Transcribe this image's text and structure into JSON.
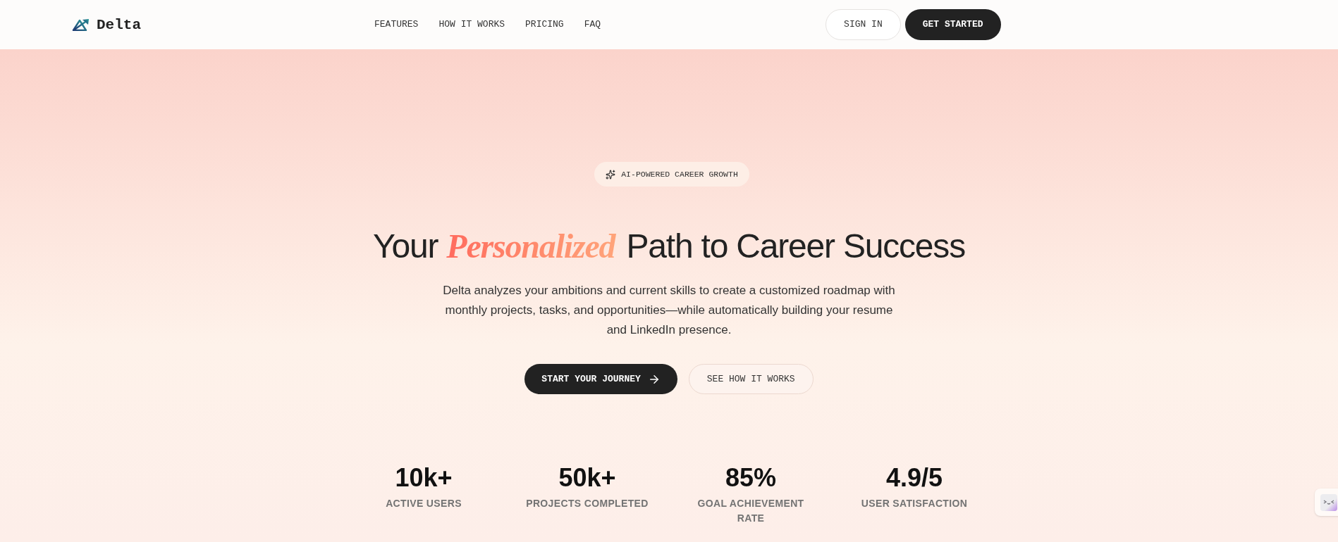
{
  "header": {
    "logo": {
      "text": "Delta"
    },
    "nav": [
      "FEATURES",
      "HOW IT WORKS",
      "PRICING",
      "FAQ"
    ],
    "buttons": [
      {
        "label": "SIGN IN",
        "kind": "outline"
      },
      {
        "label": "GET STARTED",
        "kind": "solid"
      }
    ]
  },
  "hero": {
    "badge": "AI-POWERED CAREER GROWTH",
    "heading": {
      "before": "Your",
      "highlight": "Personalized",
      "after": "Path to Career Success"
    },
    "description": "Delta analyzes your ambitions and current skills to create a customized roadmap with monthly projects, tasks, and opportunities—while automatically building your resume and LinkedIn presence.",
    "actions": [
      {
        "label": "START YOUR JOURNEY",
        "kind": "primary"
      },
      {
        "label": "SEE HOW IT WORKS",
        "kind": "secondary"
      }
    ],
    "stats": [
      {
        "value": "10k+",
        "label": "ACTIVE USERS"
      },
      {
        "value": "50k+",
        "label": "PROJECTS COMPLETED"
      },
      {
        "value": "85%",
        "label": "GOAL ACHIEVEMENT RATE"
      },
      {
        "value": "4.9/5",
        "label": "USER SATISFACTION"
      }
    ]
  }
}
